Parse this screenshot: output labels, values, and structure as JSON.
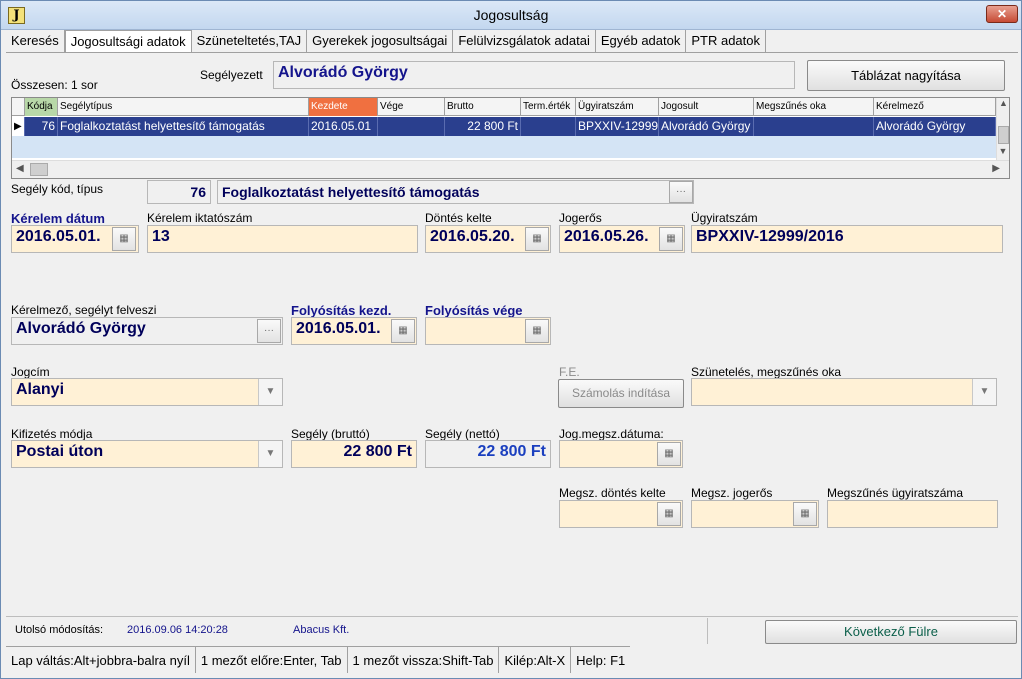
{
  "window": {
    "title": "Jogosultság",
    "app_icon": "J",
    "close_label": "✕"
  },
  "tabs": [
    {
      "label": "Keresés"
    },
    {
      "label": "Jogosultsági adatok"
    },
    {
      "label": "Szüneteltetés,TAJ"
    },
    {
      "label": "Gyerekek jogosultságai"
    },
    {
      "label": "Felülvizsgálatok adatai"
    },
    {
      "label": "Egyéb adatok"
    },
    {
      "label": "PTR adatok"
    }
  ],
  "summary": {
    "total": "Összesen: 1 sor",
    "segelyezett_label": "Segélyezett",
    "segelyezett_value": "Alvorádó György",
    "table_button": "Táblázat nagyítása"
  },
  "grid": {
    "columns": [
      "Kódja",
      "Segélytípus",
      "Kezdete",
      "Vége",
      "Brutto",
      "Term.érték",
      "Ügyiratszám",
      "Jogosult",
      "Megszűnés oka",
      "Kérelmező"
    ],
    "row": [
      "76",
      "Foglalkoztatást helyettesítő támogatás",
      "2016.05.01",
      "",
      "22 800 Ft",
      "",
      "BPXXIV-12999",
      "Alvorádó György",
      "",
      "Alvorádó György"
    ],
    "row_marker": "▶"
  },
  "form": {
    "segely_kod_label": "Segély kód, típus",
    "segely_kod_value": "76",
    "segely_tipus_value": "Foglalkoztatást helyettesítő támogatás",
    "kerelem_datum_label": "Kérelem dátum",
    "kerelem_datum_value": "2016.05.01.",
    "kerelem_iktato_label": "Kérelem iktatószám",
    "kerelem_iktato_value": "13",
    "dontes_kelte_label": "Döntés kelte",
    "dontes_kelte_value": "2016.05.20.",
    "jogeros_label": "Jogerős",
    "jogeros_value": "2016.05.26.",
    "ugyiratszam_label": "Ügyiratszám",
    "ugyiratszam_value": "BPXXIV-12999/2016",
    "kerelmezo_label": "Kérelmező, segélyt felveszi",
    "kerelmezo_value": "Alvorádó György",
    "folyositas_kezd_label": "Folyósítás kezd.",
    "folyositas_kezd_value": "2016.05.01.",
    "folyositas_vege_label": "Folyósítás vége",
    "folyositas_vege_value": "",
    "jogcim_label": "Jogcím",
    "jogcim_value": "Alanyi",
    "fe_label": "F.E.",
    "szamolas_button": "Számolás indítása",
    "szunetelés_label": "Szünetelés, megszűnés oka",
    "szunetelés_value": "",
    "kifizetes_label": "Kifizetés módja",
    "kifizetes_value": "Postai úton",
    "segely_brutto_label": "Segély (bruttó)",
    "segely_brutto_value": "22 800 Ft",
    "segely_netto_label": "Segély (nettó)",
    "segely_netto_value": "22 800 Ft",
    "jog_megsz_label": "Jog.megsz.dátuma:",
    "megsz_dontes_label": "Megsz. döntés kelte",
    "megsz_jogeros_label": "Megsz. jogerős",
    "megsz_ugyirat_label": "Megszűnés ügyiratszáma",
    "ellipsis": "···",
    "arrow": "▼",
    "cal_icon": "▦"
  },
  "footer": {
    "last_mod_label": "Utolsó módosítás:",
    "last_mod_date": "2016.09.06 14:20:28",
    "last_mod_by": "Abacus Kft.",
    "next_button": "Következő Fülre"
  },
  "statusbar": [
    "Lap váltás:Alt+jobbra-balra nyíl",
    "1 mezőt előre:Enter, Tab",
    "1 mezőt vissza:Shift-Tab",
    "Kilép:Alt-X",
    "Help: F1"
  ]
}
